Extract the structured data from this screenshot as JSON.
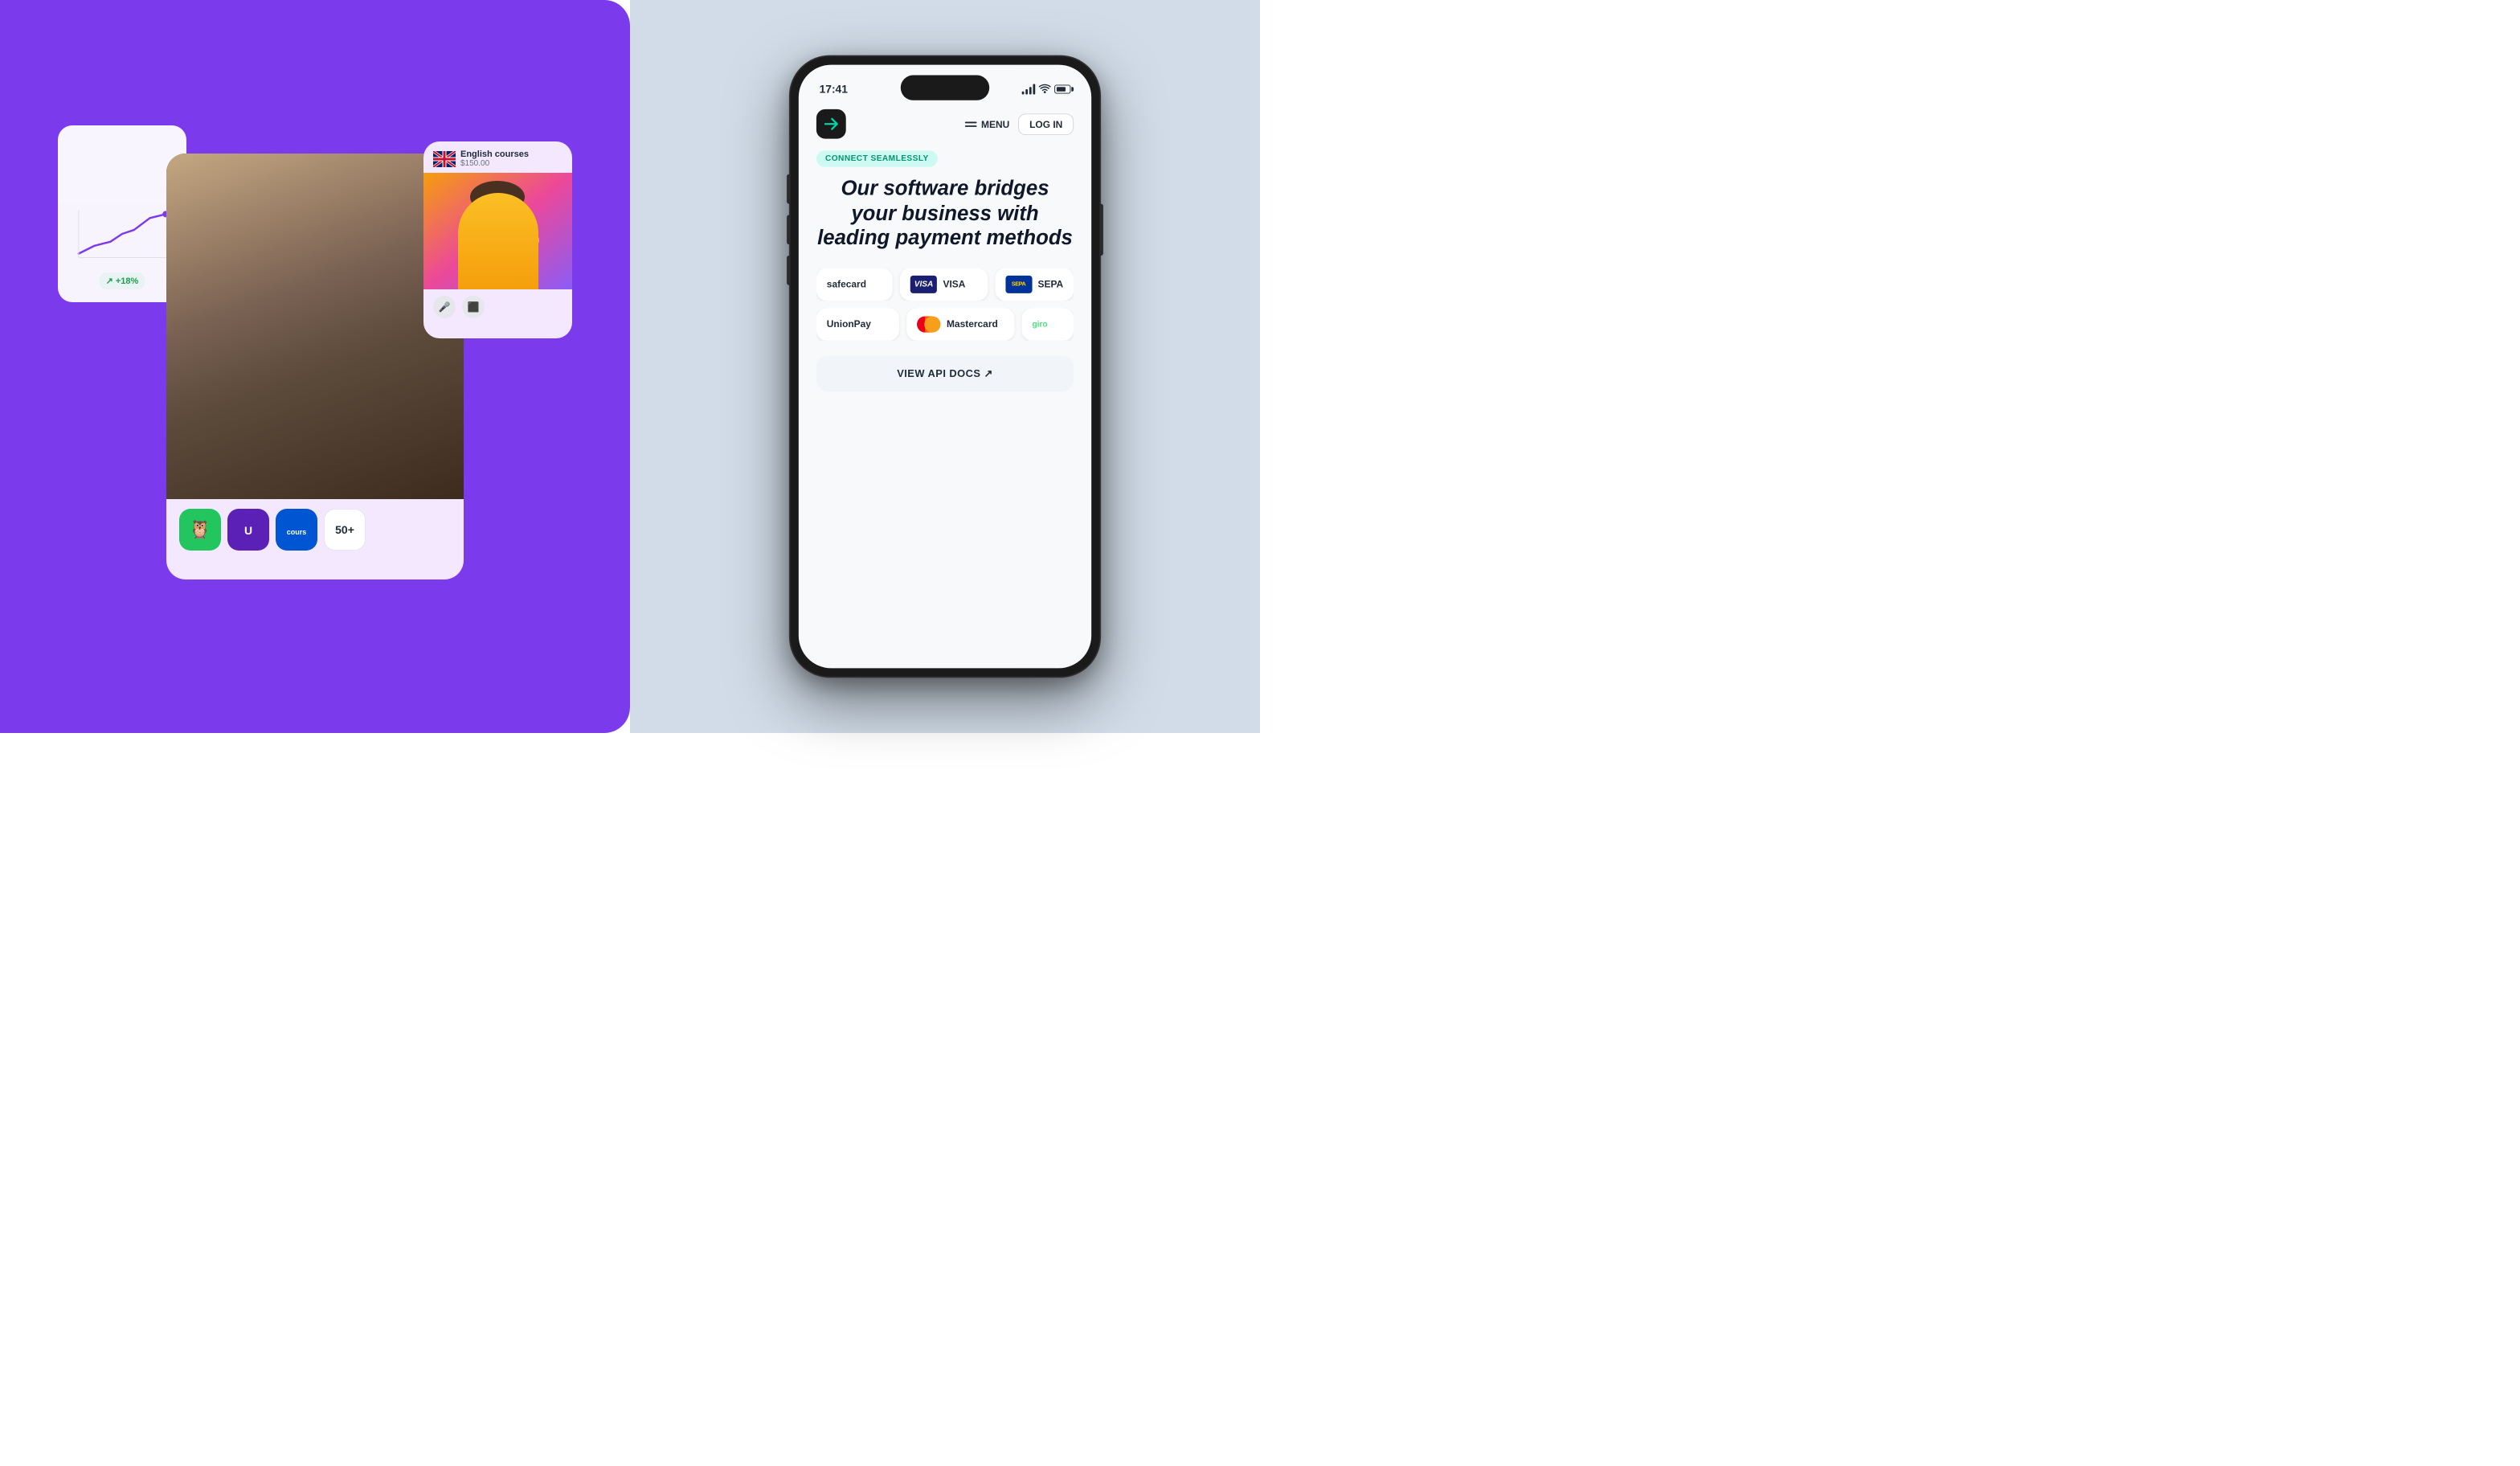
{
  "left": {
    "bg_color": "#7c3aed",
    "analytics_card": {
      "trend_badge": "+18%"
    },
    "main_card": {
      "apps": [
        {
          "name": "duolingo",
          "bg": "#22c55e",
          "emoji": "🦉"
        },
        {
          "name": "udemy",
          "bg": "#6d28d9",
          "emoji": "U"
        },
        {
          "name": "coursera",
          "bg": "#f97316",
          "text": "cours"
        },
        {
          "name": "more",
          "bg": "white",
          "text": "50+"
        }
      ]
    },
    "courses_card": {
      "language": "English courses",
      "price": "$150.00"
    }
  },
  "right": {
    "bg_color": "#d1dce8",
    "phone": {
      "status_bar": {
        "time": "17:41",
        "signal": "●●●",
        "wifi": "wifi",
        "battery": "battery"
      },
      "nav": {
        "menu_label": "MENU",
        "login_label": "LOG IN"
      },
      "badge": "CONNECT SEAMLESSLY",
      "headline": "Our software bridges your business with leading payment methods",
      "payment_methods": [
        {
          "id": "safecard",
          "label": "safecard",
          "type": "text"
        },
        {
          "id": "visa",
          "label": "VISA",
          "type": "visa"
        },
        {
          "id": "sepa",
          "label": "SEPA",
          "type": "sepa"
        },
        {
          "id": "unionpay",
          "label": "UnionPay",
          "type": "text"
        },
        {
          "id": "mastercard",
          "label": "Mastercard",
          "type": "mastercard"
        },
        {
          "id": "giropay",
          "label": "giro",
          "type": "text"
        }
      ],
      "api_button": "VIEW API DOCS ↗"
    }
  }
}
